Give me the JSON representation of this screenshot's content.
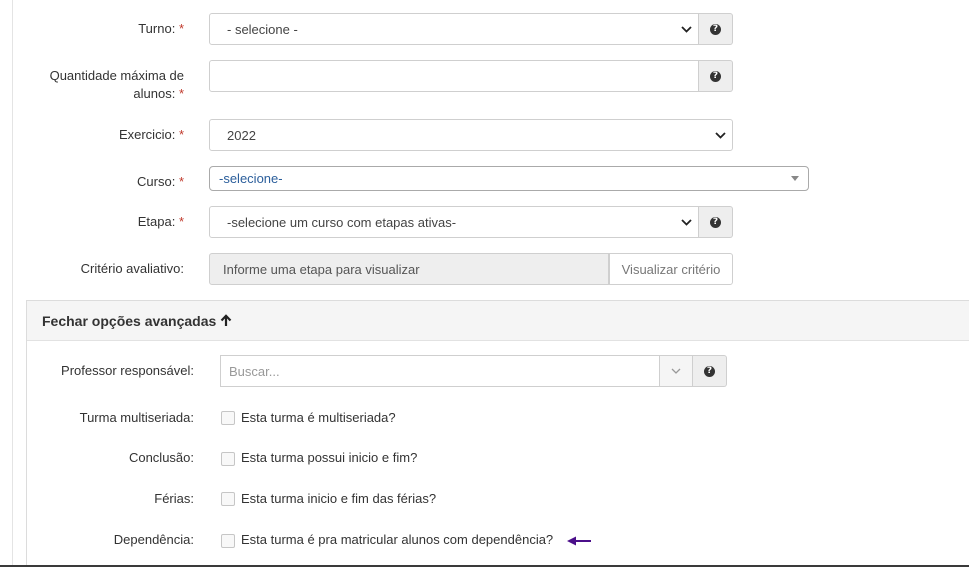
{
  "form": {
    "turno": {
      "label": "Turno:",
      "required_mark": "*",
      "value": "- selecione -"
    },
    "quantidade": {
      "label_line1": "Quantidade máxima de",
      "label_line2": "alunos:",
      "required_mark": "*",
      "value": ""
    },
    "exercicio": {
      "label": "Exercicio:",
      "required_mark": "*",
      "value": "2022"
    },
    "curso": {
      "label": "Curso:",
      "required_mark": "*",
      "value": "-selecione-"
    },
    "etapa": {
      "label": "Etapa:",
      "required_mark": "*",
      "value": "-selecione um curso com etapas ativas-"
    },
    "criterio": {
      "label": "Critério avaliativo:",
      "value": "Informe uma etapa para visualizar",
      "button_label": "Visualizar critério"
    }
  },
  "advanced": {
    "header": "Fechar opções avançadas",
    "professor": {
      "label": "Professor responsável:",
      "placeholder": "Buscar..."
    },
    "multiseriada": {
      "label": "Turma multiseriada:",
      "checkbox_label": "Esta turma é multiseriada?",
      "checked": false
    },
    "conclusao": {
      "label": "Conclusão:",
      "checkbox_label": "Esta turma possui inicio e fim?",
      "checked": false
    },
    "ferias": {
      "label": "Férias:",
      "checkbox_label": "Esta turma inicio e fim das férias?",
      "checked": false
    },
    "dependencia": {
      "label": "Dependência:",
      "checkbox_label": "Esta turma é pra matricular alunos com dependência?",
      "checked": false
    }
  },
  "icons": {
    "help": "question-circle-icon",
    "chevron": "chevron-down-icon",
    "arrow_up": "arrow-up-icon",
    "pointer": "arrow-left-annotation-icon"
  },
  "colors": {
    "required": "#c0392b",
    "select2_text": "#2b5e9b",
    "annotation_arrow": "#4b0f8a"
  }
}
